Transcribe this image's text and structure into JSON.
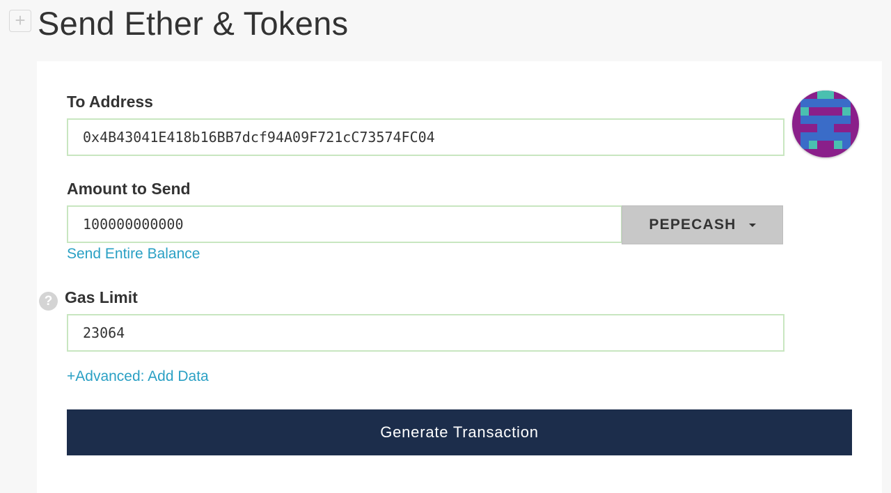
{
  "header": {
    "collapse_icon": "plus-icon",
    "collapse_glyph": "+",
    "title": "Send Ether & Tokens"
  },
  "form": {
    "to_address": {
      "label": "To Address",
      "value": "0x4B43041E418b16BB7dcf94A09F721cC73574FC04",
      "identicon": "address-identicon"
    },
    "amount": {
      "label": "Amount to Send",
      "value": "100000000000",
      "token": "PEPECASH",
      "send_entire_balance": "Send Entire Balance"
    },
    "gas_limit": {
      "label": "Gas Limit",
      "value": "23064",
      "help_glyph": "?"
    },
    "advanced_link": "+Advanced: Add Data",
    "generate_button": "Generate Transaction"
  },
  "colors": {
    "page_bg": "#f7f7f7",
    "card_bg": "#ffffff",
    "input_border": "#c8e6c0",
    "link": "#2aa0c4",
    "primary_button": "#1c2d4b",
    "token_select_bg": "#c8c8c8",
    "identicon_purple": "#8a1f8a",
    "identicon_blue": "#3a6cc8",
    "identicon_teal": "#4ac0b0"
  }
}
